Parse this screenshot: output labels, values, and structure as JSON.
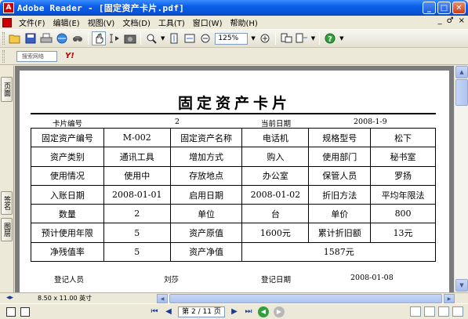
{
  "window": {
    "title": "Adobe Reader - [固定资产卡片.pdf]",
    "minimize_label": "_",
    "maximize_label": "□",
    "close_label": "✕"
  },
  "menu": {
    "items": [
      "文件(F)",
      "编辑(E)",
      "视图(V)",
      "文档(D)",
      "工具(T)",
      "窗口(W)",
      "帮助(H)"
    ],
    "right": [
      "_",
      "♂",
      "×"
    ]
  },
  "toolbar": {
    "zoom_value": "125%"
  },
  "searchbar": {
    "placeholder": "搜索网络",
    "brand": "Y!"
  },
  "sidetabs": {
    "pages": "页面",
    "signatures": "签名",
    "layers": "图层"
  },
  "document": {
    "title": "固定资产卡片",
    "header": {
      "card_no_label": "卡片编号",
      "card_no_value": "2",
      "date_label": "当前日期",
      "date_value": "2008-1-9"
    },
    "rows": [
      [
        "固定资产编号",
        "M-002",
        "固定资产名称",
        "电话机",
        "规格型号",
        "松下"
      ],
      [
        "资产类别",
        "通讯工具",
        "增加方式",
        "购入",
        "使用部门",
        "秘书室"
      ],
      [
        "使用情况",
        "使用中",
        "存放地点",
        "办公室",
        "保管人员",
        "罗扬"
      ],
      [
        "入账日期",
        "2008-01-01",
        "启用日期",
        "2008-01-02",
        "折旧方法",
        "平均年限法"
      ],
      [
        "数量",
        "2",
        "单位",
        "台",
        "单价",
        "800"
      ],
      [
        "预计使用年限",
        "5",
        "资产原值",
        "1600元",
        "累计折旧额",
        "13元"
      ],
      [
        "净残值率",
        "5",
        "资产净值",
        "1587元"
      ]
    ],
    "footer": {
      "registrar_label": "登记人员",
      "registrar_value": "刘莎",
      "reg_date_label": "登记日期",
      "reg_date_value": "2008-01-08"
    }
  },
  "status": {
    "page_size": "8.50 x 11.00 英寸",
    "page_indicator": "第 2 / 11 页"
  }
}
